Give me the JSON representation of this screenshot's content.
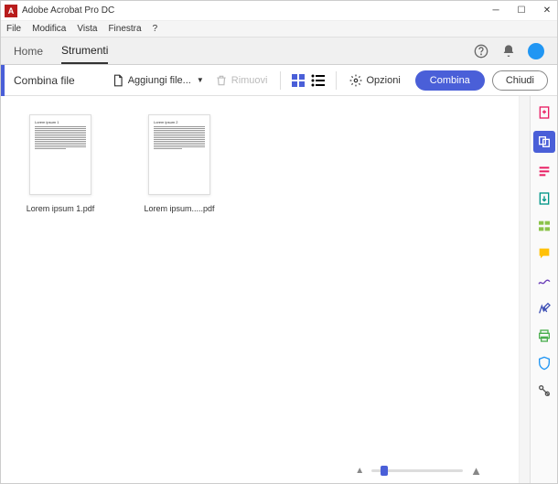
{
  "titlebar": {
    "app_icon": "A",
    "title": "Adobe Acrobat Pro DC"
  },
  "menubar": {
    "file": "File",
    "modifica": "Modifica",
    "vista": "Vista",
    "finestra": "Finestra",
    "help": "?"
  },
  "navbar": {
    "home": "Home",
    "strumenti": "Strumenti"
  },
  "toolbar": {
    "title": "Combina file",
    "aggiungi": "Aggiungi file...",
    "rimuovi": "Rimuovi",
    "opzioni": "Opzioni",
    "combina": "Combina",
    "chiudi": "Chiudi"
  },
  "files": [
    {
      "thumb_title": "Lorem ipsum 1",
      "name": "Lorem ipsum 1.pdf"
    },
    {
      "thumb_title": "Lorem ipsum 2",
      "name": "Lorem ipsum.....pdf"
    }
  ]
}
